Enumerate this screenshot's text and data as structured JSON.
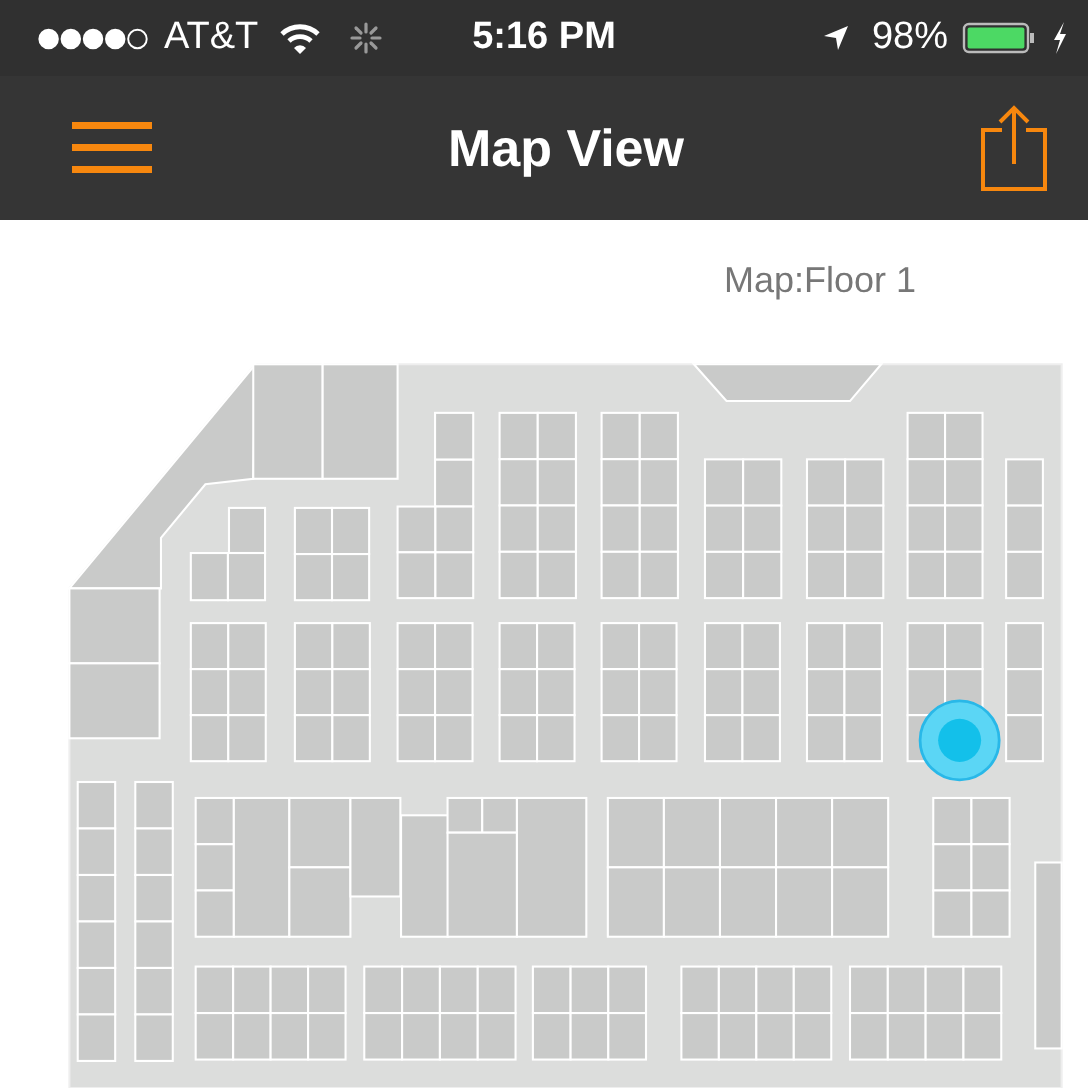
{
  "status_bar": {
    "carrier": "AT&T",
    "time": "5:16 PM",
    "battery": "98%"
  },
  "nav_bar": {
    "title": "Map View"
  },
  "map": {
    "label": "Map:Floor 1"
  }
}
